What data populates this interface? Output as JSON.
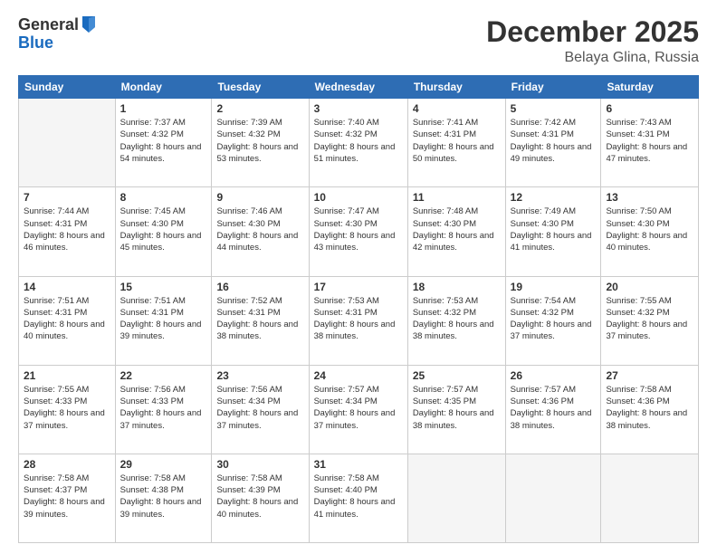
{
  "logo": {
    "general": "General",
    "blue": "Blue"
  },
  "header": {
    "month": "December 2025",
    "location": "Belaya Glina, Russia"
  },
  "weekdays": [
    "Sunday",
    "Monday",
    "Tuesday",
    "Wednesday",
    "Thursday",
    "Friday",
    "Saturday"
  ],
  "weeks": [
    [
      {
        "day": "",
        "empty": true
      },
      {
        "day": "1",
        "sunrise": "7:37 AM",
        "sunset": "4:32 PM",
        "daylight": "8 hours and 54 minutes."
      },
      {
        "day": "2",
        "sunrise": "7:39 AM",
        "sunset": "4:32 PM",
        "daylight": "8 hours and 53 minutes."
      },
      {
        "day": "3",
        "sunrise": "7:40 AM",
        "sunset": "4:32 PM",
        "daylight": "8 hours and 51 minutes."
      },
      {
        "day": "4",
        "sunrise": "7:41 AM",
        "sunset": "4:31 PM",
        "daylight": "8 hours and 50 minutes."
      },
      {
        "day": "5",
        "sunrise": "7:42 AM",
        "sunset": "4:31 PM",
        "daylight": "8 hours and 49 minutes."
      },
      {
        "day": "6",
        "sunrise": "7:43 AM",
        "sunset": "4:31 PM",
        "daylight": "8 hours and 47 minutes."
      }
    ],
    [
      {
        "day": "7",
        "sunrise": "7:44 AM",
        "sunset": "4:31 PM",
        "daylight": "8 hours and 46 minutes."
      },
      {
        "day": "8",
        "sunrise": "7:45 AM",
        "sunset": "4:30 PM",
        "daylight": "8 hours and 45 minutes."
      },
      {
        "day": "9",
        "sunrise": "7:46 AM",
        "sunset": "4:30 PM",
        "daylight": "8 hours and 44 minutes."
      },
      {
        "day": "10",
        "sunrise": "7:47 AM",
        "sunset": "4:30 PM",
        "daylight": "8 hours and 43 minutes."
      },
      {
        "day": "11",
        "sunrise": "7:48 AM",
        "sunset": "4:30 PM",
        "daylight": "8 hours and 42 minutes."
      },
      {
        "day": "12",
        "sunrise": "7:49 AM",
        "sunset": "4:30 PM",
        "daylight": "8 hours and 41 minutes."
      },
      {
        "day": "13",
        "sunrise": "7:50 AM",
        "sunset": "4:30 PM",
        "daylight": "8 hours and 40 minutes."
      }
    ],
    [
      {
        "day": "14",
        "sunrise": "7:51 AM",
        "sunset": "4:31 PM",
        "daylight": "8 hours and 40 minutes."
      },
      {
        "day": "15",
        "sunrise": "7:51 AM",
        "sunset": "4:31 PM",
        "daylight": "8 hours and 39 minutes."
      },
      {
        "day": "16",
        "sunrise": "7:52 AM",
        "sunset": "4:31 PM",
        "daylight": "8 hours and 38 minutes."
      },
      {
        "day": "17",
        "sunrise": "7:53 AM",
        "sunset": "4:31 PM",
        "daylight": "8 hours and 38 minutes."
      },
      {
        "day": "18",
        "sunrise": "7:53 AM",
        "sunset": "4:32 PM",
        "daylight": "8 hours and 38 minutes."
      },
      {
        "day": "19",
        "sunrise": "7:54 AM",
        "sunset": "4:32 PM",
        "daylight": "8 hours and 37 minutes."
      },
      {
        "day": "20",
        "sunrise": "7:55 AM",
        "sunset": "4:32 PM",
        "daylight": "8 hours and 37 minutes."
      }
    ],
    [
      {
        "day": "21",
        "sunrise": "7:55 AM",
        "sunset": "4:33 PM",
        "daylight": "8 hours and 37 minutes."
      },
      {
        "day": "22",
        "sunrise": "7:56 AM",
        "sunset": "4:33 PM",
        "daylight": "8 hours and 37 minutes."
      },
      {
        "day": "23",
        "sunrise": "7:56 AM",
        "sunset": "4:34 PM",
        "daylight": "8 hours and 37 minutes."
      },
      {
        "day": "24",
        "sunrise": "7:57 AM",
        "sunset": "4:34 PM",
        "daylight": "8 hours and 37 minutes."
      },
      {
        "day": "25",
        "sunrise": "7:57 AM",
        "sunset": "4:35 PM",
        "daylight": "8 hours and 38 minutes."
      },
      {
        "day": "26",
        "sunrise": "7:57 AM",
        "sunset": "4:36 PM",
        "daylight": "8 hours and 38 minutes."
      },
      {
        "day": "27",
        "sunrise": "7:58 AM",
        "sunset": "4:36 PM",
        "daylight": "8 hours and 38 minutes."
      }
    ],
    [
      {
        "day": "28",
        "sunrise": "7:58 AM",
        "sunset": "4:37 PM",
        "daylight": "8 hours and 39 minutes."
      },
      {
        "day": "29",
        "sunrise": "7:58 AM",
        "sunset": "4:38 PM",
        "daylight": "8 hours and 39 minutes."
      },
      {
        "day": "30",
        "sunrise": "7:58 AM",
        "sunset": "4:39 PM",
        "daylight": "8 hours and 40 minutes."
      },
      {
        "day": "31",
        "sunrise": "7:58 AM",
        "sunset": "4:40 PM",
        "daylight": "8 hours and 41 minutes."
      },
      {
        "day": "",
        "empty": true
      },
      {
        "day": "",
        "empty": true
      },
      {
        "day": "",
        "empty": true
      }
    ]
  ]
}
